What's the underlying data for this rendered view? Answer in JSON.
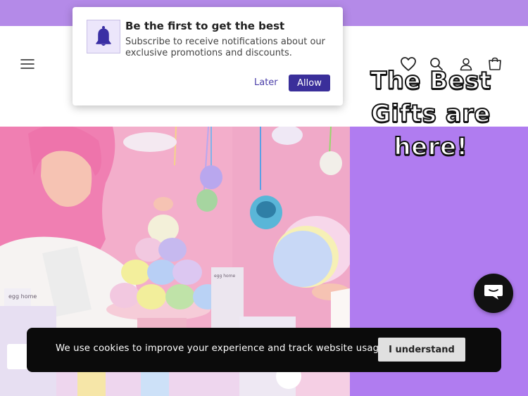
{
  "colors": {
    "announcement_bg": "#b48ae8",
    "hero_panel_bg": "#b07cf0",
    "cookie_bar_bg": "#0b0b0b",
    "allow_button_bg": "#3a2f9a"
  },
  "header": {
    "icons": [
      "menu-icon",
      "heart-icon",
      "search-icon",
      "account-icon",
      "cart-icon"
    ]
  },
  "notification": {
    "title": "Be the first to get the best",
    "body": "Subscribe to receive notifications about our exclusive promotions and discounts.",
    "later_label": "Later",
    "allow_label": "Allow",
    "icon": "bell-icon"
  },
  "hero": {
    "heading_lines": [
      "The Best",
      "Gifts are",
      "here!"
    ],
    "photo_texts": [
      "egg home",
      "egg home"
    ]
  },
  "cookie": {
    "text": "We use cookies to improve your experience and track website usage.",
    "button_label": "I understand"
  },
  "chat": {
    "icon": "chat-bubble-icon"
  }
}
